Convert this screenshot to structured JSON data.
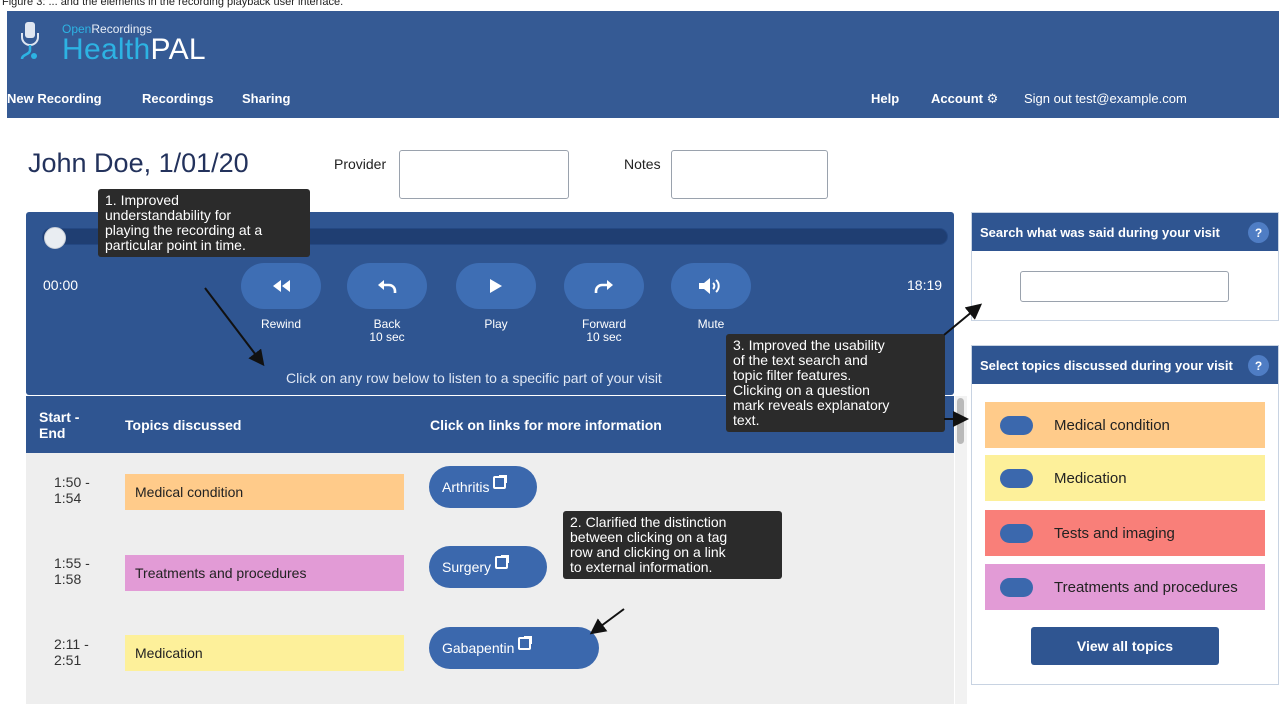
{
  "caption": "Figure 3: ... and the elements in the recording playback user interface.",
  "brand": {
    "small_a": "Open",
    "small_b": "Recordings",
    "big_a": "Health",
    "big_b": "PAL"
  },
  "nav": {
    "new_recording": "New Recording",
    "recordings": "Recordings",
    "sharing": "Sharing",
    "help": "Help",
    "account": "Account",
    "sign_out": "Sign out test@example.com"
  },
  "patient": {
    "name": "John Doe, 1/01/20",
    "provider_label": "Provider",
    "provider_value": "",
    "notes_label": "Notes",
    "notes_value": ""
  },
  "player": {
    "current_time": "00:00",
    "total_time": "18:19",
    "progress": 0,
    "controls": [
      {
        "label": "Rewind",
        "sub": ""
      },
      {
        "label": "Back",
        "sub": "10 sec"
      },
      {
        "label": "Play",
        "sub": ""
      },
      {
        "label": "Forward",
        "sub": "10 sec"
      },
      {
        "label": "Mute",
        "sub": ""
      }
    ],
    "hint": "Click on any row below to listen to a specific part of your visit"
  },
  "table": {
    "headers": {
      "start_end_1": "Start -",
      "start_end_2": "End",
      "topics": "Topics discussed",
      "links": "Click on links for more information"
    },
    "rows": [
      {
        "start": "1:50 -",
        "end": "1:54",
        "topic": "Medical condition",
        "link": "Arthritis"
      },
      {
        "start": "1:55 -",
        "end": "1:58",
        "topic": "Treatments and procedures",
        "link": "Surgery"
      },
      {
        "start": "2:11 -",
        "end": "2:51",
        "topic": "Medication",
        "link": "Gabapentin"
      }
    ]
  },
  "search_panel": {
    "title": "Search what was said during your visit",
    "help": "?",
    "query": ""
  },
  "topics_panel": {
    "title": "Select topics discussed during your visit",
    "help": "?",
    "topics": [
      {
        "label": "Medical condition"
      },
      {
        "label": "Medication"
      },
      {
        "label": "Tests and imaging"
      },
      {
        "label": "Treatments and procedures"
      }
    ],
    "view_all": "View all topics"
  },
  "colors": {
    "medical_condition": "#ffcb8a",
    "medication": "#fdf09a",
    "tests_and_imaging": "#f97f79",
    "treatments_and_procedures": "#e29bd6"
  },
  "callouts": {
    "c1": [
      "1. Improved",
      "understandability for",
      "playing the recording at a",
      "particular point in time."
    ],
    "c2": [
      "2. Clarified the distinction",
      "between clicking on a tag",
      "row and clicking on a link",
      "to external information."
    ],
    "c3": [
      "3. Improved the usability",
      "of the text search and",
      "topic filter features.",
      "Clicking on a question",
      "mark reveals explanatory",
      "text."
    ]
  }
}
